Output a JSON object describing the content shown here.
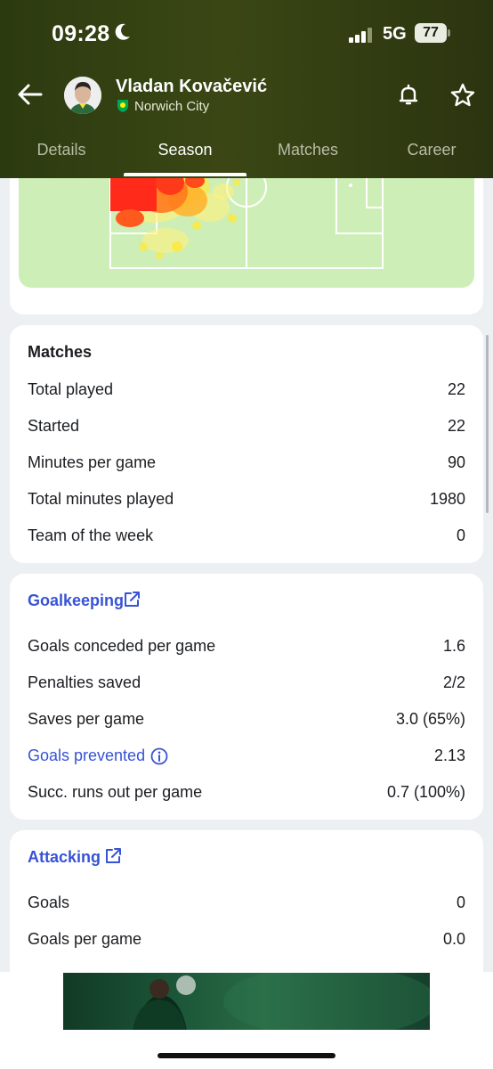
{
  "status": {
    "time": "09:28",
    "network": "5G",
    "battery": "77"
  },
  "player": {
    "name": "Vladan Kovačević",
    "club": "Norwich City"
  },
  "tabs": [
    "Details",
    "Season",
    "Matches",
    "Career"
  ],
  "active_tab": "Season",
  "matches": {
    "title": "Matches",
    "rows": [
      {
        "label": "Total played",
        "value": "22"
      },
      {
        "label": "Started",
        "value": "22"
      },
      {
        "label": "Minutes per game",
        "value": "90"
      },
      {
        "label": "Total minutes played",
        "value": "1980"
      },
      {
        "label": "Team of the week",
        "value": "0"
      }
    ]
  },
  "goalkeeping": {
    "title": "Goalkeeping",
    "rows": [
      {
        "label": "Goals conceded per game",
        "value": "1.6"
      },
      {
        "label": "Penalties saved",
        "value": "2/2"
      },
      {
        "label": "Saves per game",
        "value": "3.0 (65%)"
      },
      {
        "label": "Goals prevented",
        "value": "2.13"
      },
      {
        "label": "Succ. runs out per game",
        "value": "0.7 (100%)"
      }
    ]
  },
  "attacking": {
    "title": "Attacking",
    "rows": [
      {
        "label": "Goals",
        "value": "0"
      },
      {
        "label": "Goals per game",
        "value": "0.0"
      }
    ]
  },
  "colors": {
    "header": "#33420f",
    "link": "#3753d6",
    "pitch": "#cdeeb6",
    "heat_hot": "#ff2a1a",
    "heat_warm": "#ffe93a"
  },
  "icons": [
    "back-arrow-icon",
    "bell-icon",
    "star-icon",
    "external-link-icon",
    "info-icon",
    "moon-icon",
    "signal-icon",
    "club-crest-icon"
  ]
}
